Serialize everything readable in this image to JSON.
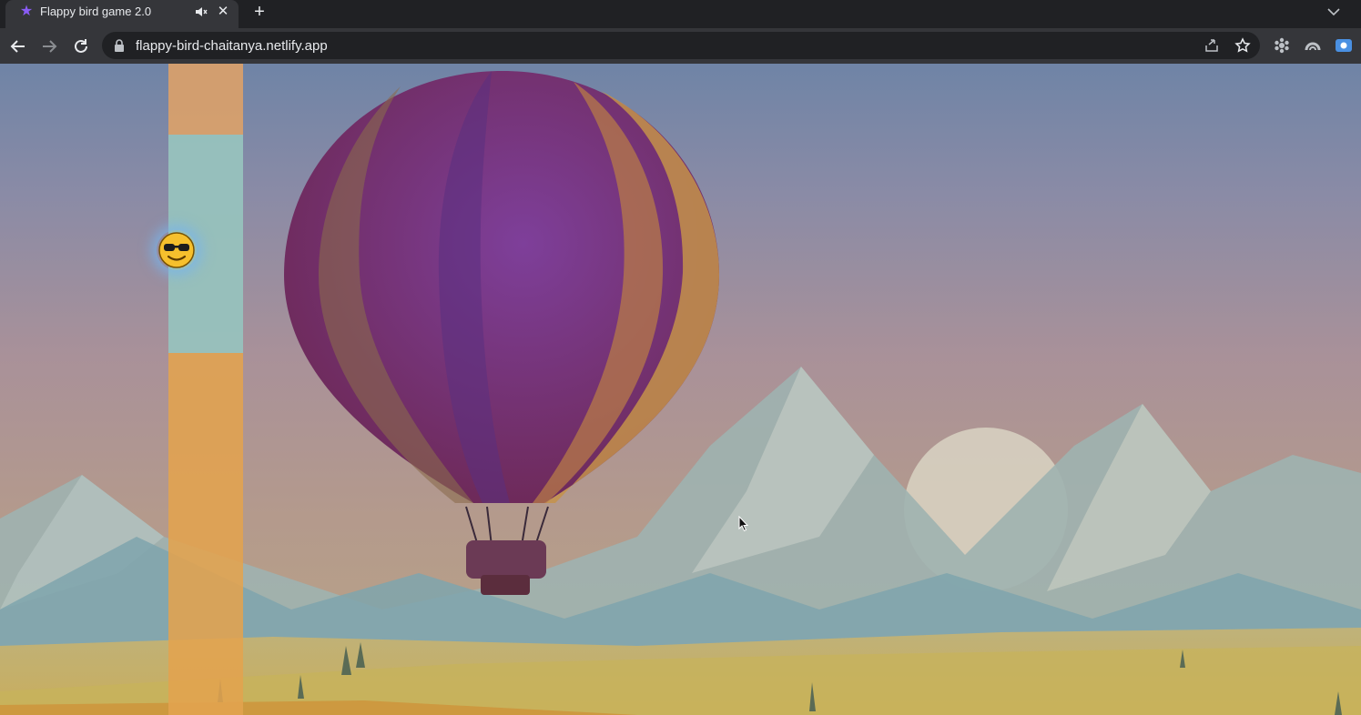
{
  "browser": {
    "tab": {
      "title": "Flappy bird game 2.0",
      "favicon": "star-icon",
      "audio_icon": "speaker-muted-icon",
      "close_icon": "close-icon"
    },
    "new_tab_icon": "plus-icon",
    "tab_search_icon": "chevron-down-icon",
    "nav": {
      "back_icon": "back-arrow-icon",
      "forward_icon": "forward-arrow-icon",
      "reload_icon": "reload-icon"
    },
    "address_bar": {
      "lock_icon": "lock-icon",
      "url": "flappy-bird-chaitanya.netlify.app",
      "share_icon": "share-icon",
      "bookmark_icon": "star-outline-icon"
    },
    "extensions": [
      "extension-icon",
      "arc-extension-icon",
      "screen-recorder-icon"
    ]
  },
  "game": {
    "player_emoji": "😎",
    "colors": {
      "pipe_top": "#d9a06a",
      "pipe_gap": "#97c2bd",
      "pipe_bottom": "#e3a34f",
      "bird_glow": "#78b4eb"
    },
    "background": [
      "hot-air-balloon",
      "mountains",
      "sun",
      "fields"
    ]
  }
}
